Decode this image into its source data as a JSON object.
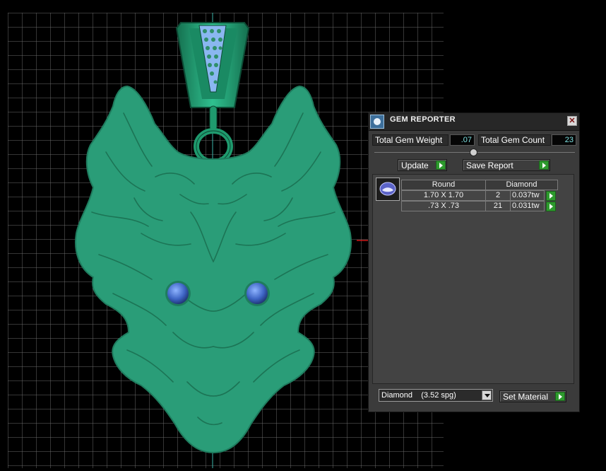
{
  "panel": {
    "title": "GEM REPORTER",
    "close": "✕",
    "total_weight_label": "Total Gem Weight",
    "total_weight_value": ".07",
    "total_count_label": "Total Gem Count",
    "total_count_value": "23",
    "update_label": "Update",
    "save_report_label": "Save Report",
    "table": {
      "shape": "Round",
      "material": "Diamond",
      "rows": [
        {
          "size": "1.70 X 1.70",
          "count": "2",
          "weight": "0.037tw"
        },
        {
          "size": ".73 X .73",
          "count": "21",
          "weight": "0.031tw"
        }
      ]
    },
    "material_select": "Diamond    (3.52 spg)",
    "set_material_label": "Set Material"
  },
  "icons": {
    "title": "gem-reporter-icon",
    "close": "close-icon",
    "thumb": "round-gem-icon",
    "go": "green-arrow-icon",
    "dropdown": "chevron-down-icon"
  },
  "colors": {
    "model_green": "#2a9d78",
    "stone_blue": "#3d64c4",
    "grid": "#6f6f6f",
    "panel_bg": "#3b3b3b",
    "go_green": "#2d9a2d"
  }
}
